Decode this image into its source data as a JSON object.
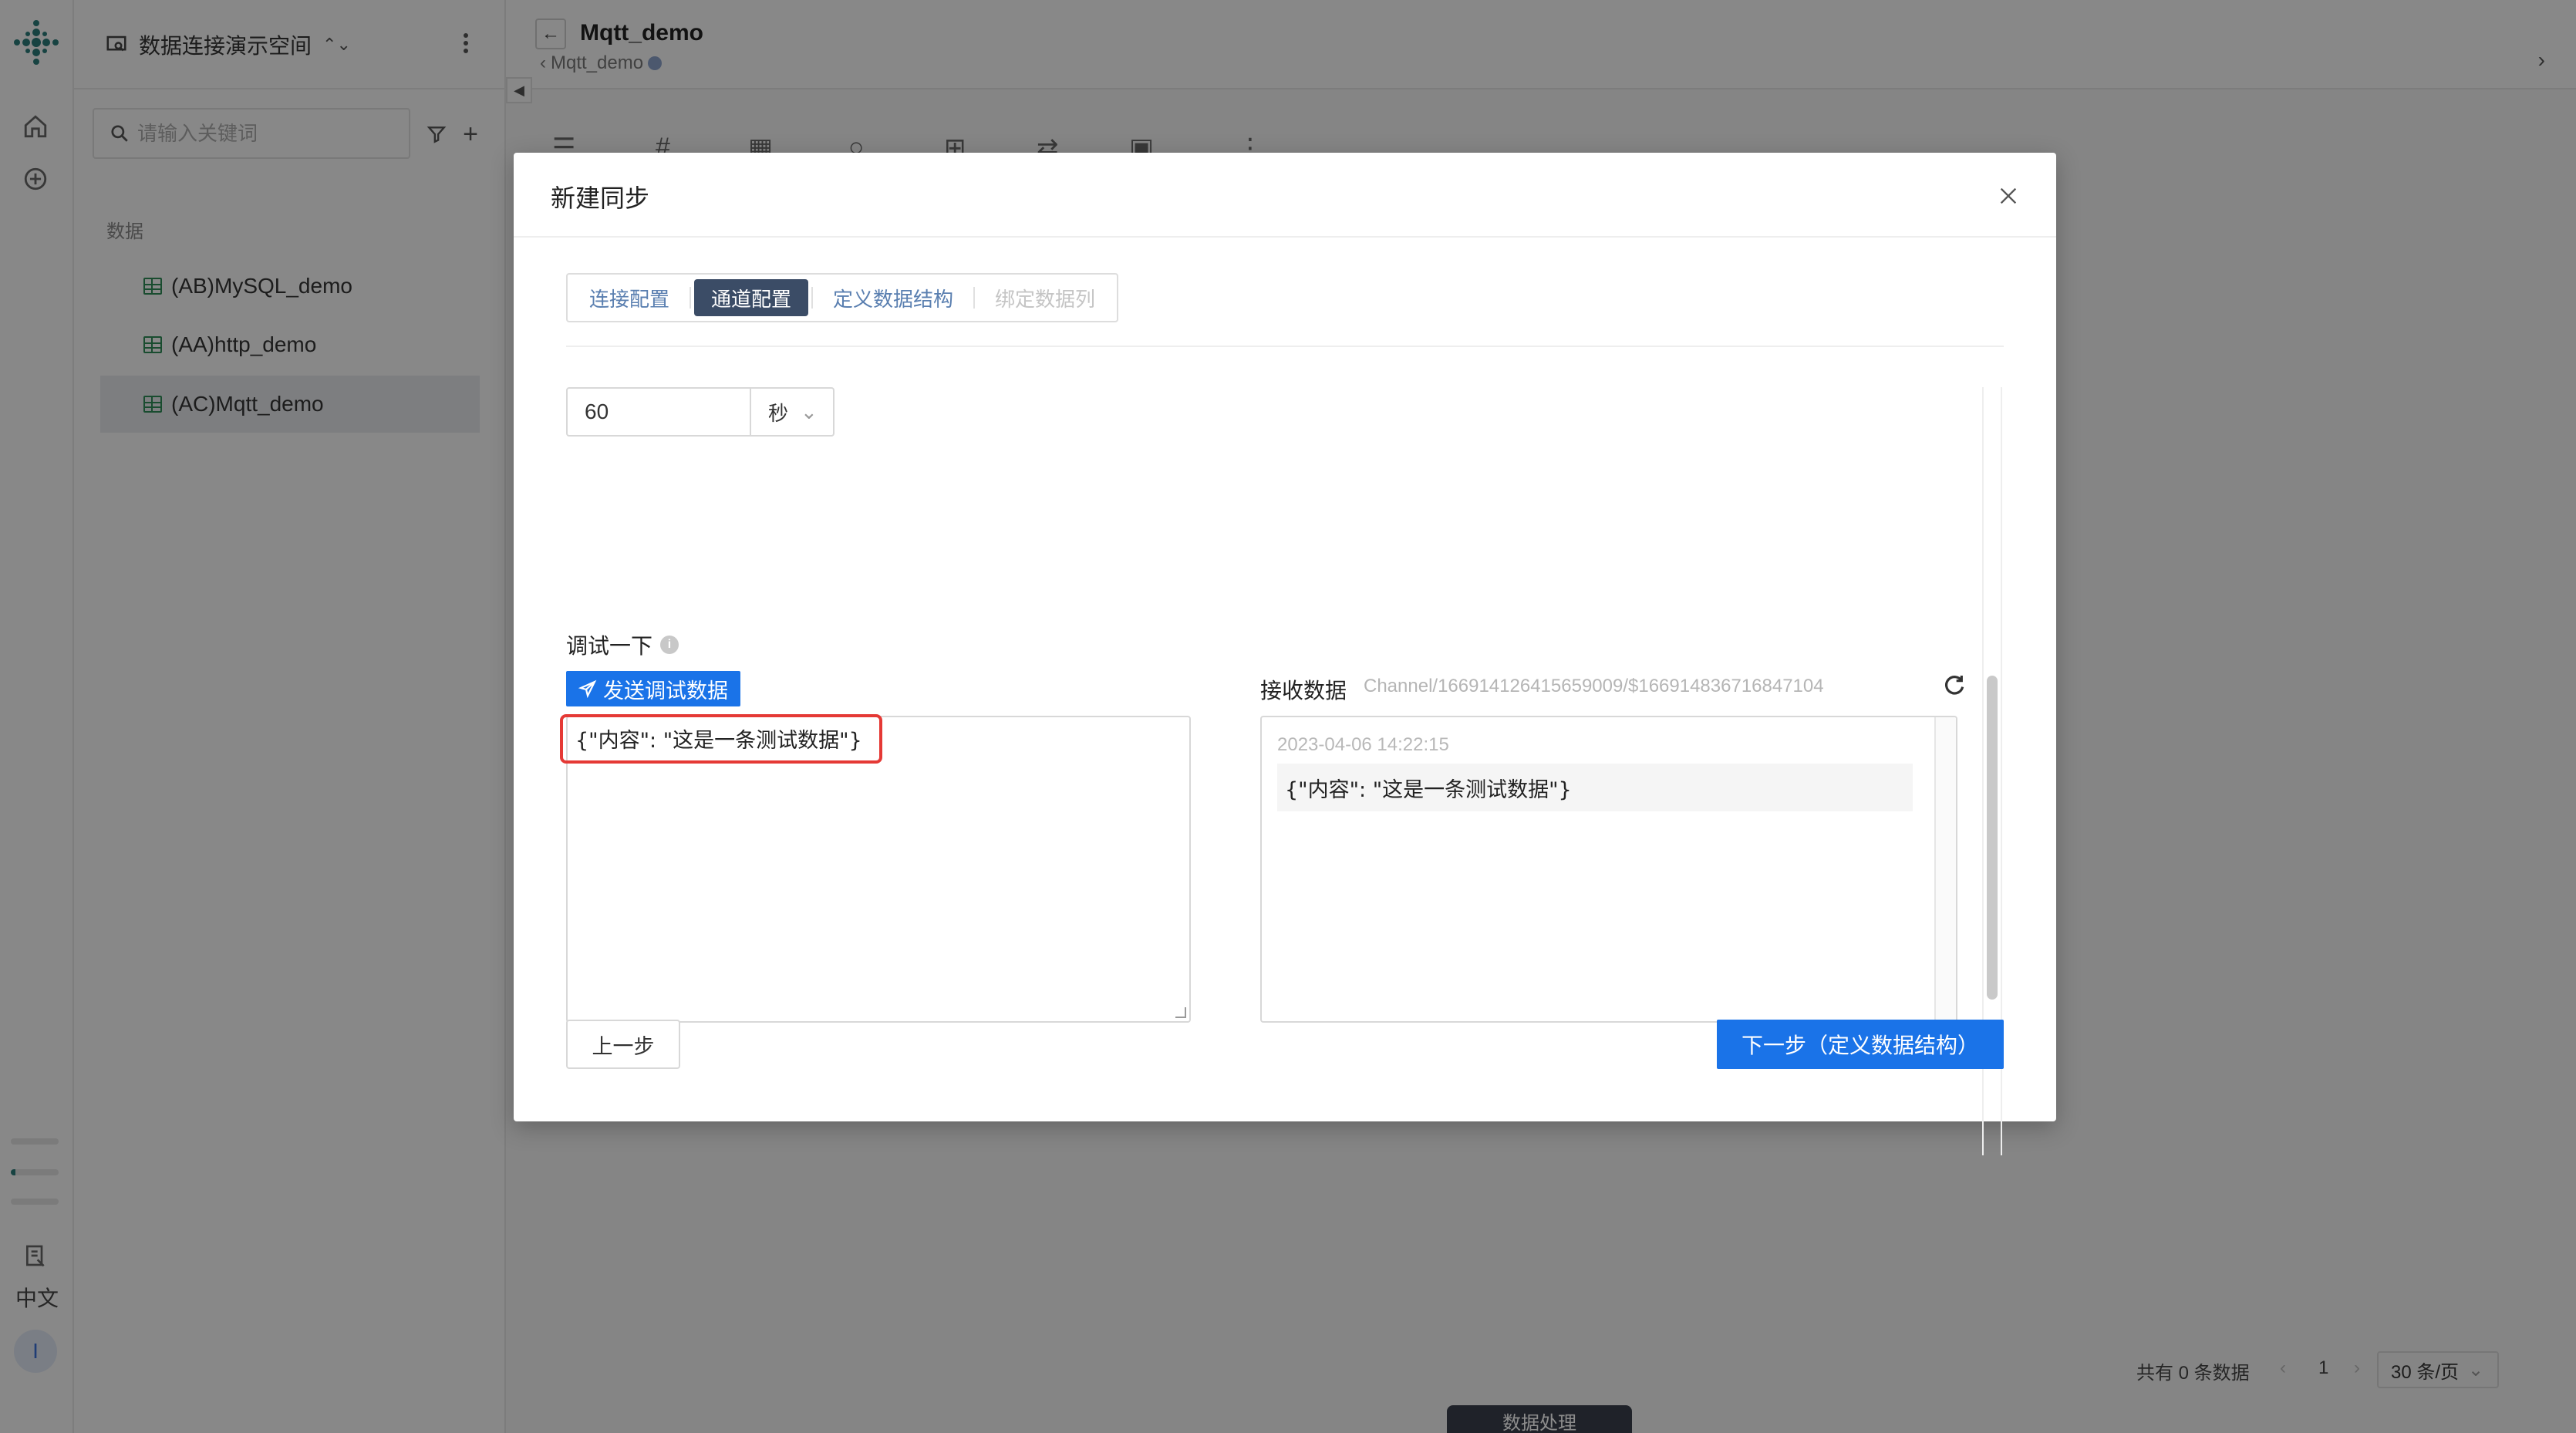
{
  "rail": {
    "lang_label": "中文",
    "avatar_letter": "I"
  },
  "sidebar": {
    "workspace_name": "数据连接演示空间",
    "search_placeholder": "请输入关键词",
    "section_label": "数据",
    "items": [
      {
        "label": "(AB)MySQL_demo"
      },
      {
        "label": "(AA)http_demo"
      },
      {
        "label": "(AC)Mqtt_demo",
        "active": true
      }
    ]
  },
  "header": {
    "title": "Mqtt_demo",
    "breadcrumb": "Mqtt_demo"
  },
  "footer": {
    "total_text": "共有 0 条数据",
    "page": "1",
    "page_size": "30 条/页",
    "bottom_tab": "数据处理"
  },
  "modal": {
    "title": "新建同步",
    "steps": [
      {
        "label": "连接配置",
        "state": "done"
      },
      {
        "label": "通道配置",
        "state": "active"
      },
      {
        "label": "定义数据结构",
        "state": "todo"
      },
      {
        "label": "绑定数据列",
        "state": "disabled"
      }
    ],
    "interval_value": "60",
    "interval_unit": "秒",
    "debug_label": "调试一下",
    "send_button": "发送调试数据",
    "send_payload": "{\"内容\": \"这是一条测试数据\"}",
    "receive_label": "接收数据",
    "receive_channel": "Channel/166914126415659009/$166914836716847104",
    "received": {
      "time": "2023-04-06 14:22:15",
      "message": "{\"内容\": \"这是一条测试数据\"}"
    },
    "prev_button": "上一步",
    "next_button": "下一步（定义数据结构）"
  },
  "colors": {
    "primary": "#1a73e8",
    "active_step": "#3b4c66",
    "highlight": "#e53935"
  }
}
